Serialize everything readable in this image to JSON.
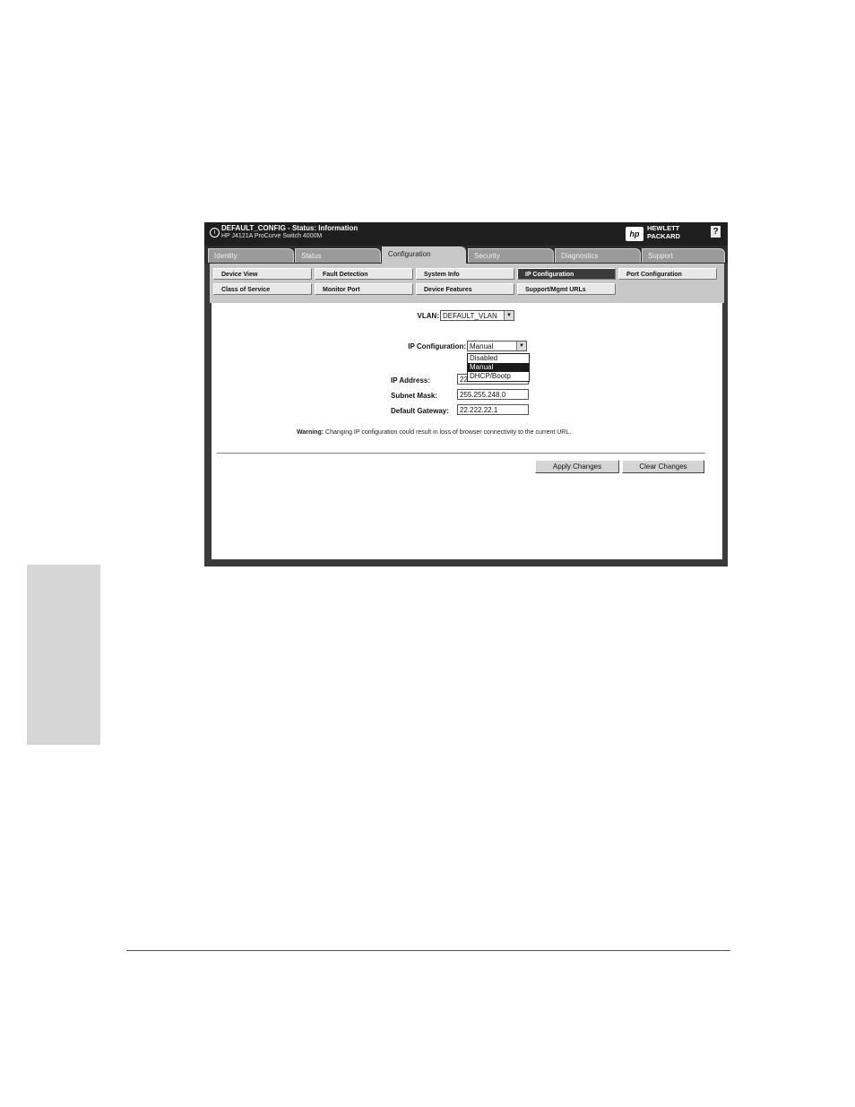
{
  "window": {
    "title_line1": "DEFAULT_CONFIG - Status: Information",
    "title_line2": "HP J4121A ProCurve Switch 4000M",
    "brand_line1": "HEWLETT",
    "brand_line2": "PACKARD",
    "logo_text": "hp",
    "help_label": "?"
  },
  "tabs": [
    {
      "label": "Identity"
    },
    {
      "label": "Status"
    },
    {
      "label": "Configuration",
      "active": true
    },
    {
      "label": "Security"
    },
    {
      "label": "Diagnostics"
    },
    {
      "label": "Support"
    }
  ],
  "subnav": {
    "row1": [
      "Device View",
      "Fault Detection",
      "System Info",
      "IP Configuration",
      "Port Configuration"
    ],
    "row2": [
      "Class of Service",
      "Monitor Port",
      "Device Features",
      "Support/Mgmt URLs"
    ],
    "active": "IP Configuration"
  },
  "form": {
    "vlan_label": "VLAN:",
    "vlan_value": "DEFAULT_VLAN",
    "ipconfig_label": "IP Configuration:",
    "ipconfig_value": "Manual",
    "ipconfig_options": [
      "Disabled",
      "Manual",
      "DHCP/Bootp"
    ],
    "ipconfig_highlighted": "Manual",
    "ip_address_label": "IP Address:",
    "ip_address_value": "22.222.222",
    "subnet_mask_label": "Subnet Mask:",
    "subnet_mask_value": "255.255.248.0",
    "gateway_label": "Default Gateway:",
    "gateway_value": "22.222.22.1",
    "warning_prefix": "Warning:",
    "warning_text": " Changing IP configuration could result in loss of browser connectivity to the current URL."
  },
  "buttons": {
    "apply": "Apply Changes",
    "clear": "Clear Changes"
  },
  "dropdown_arrow": "▼"
}
